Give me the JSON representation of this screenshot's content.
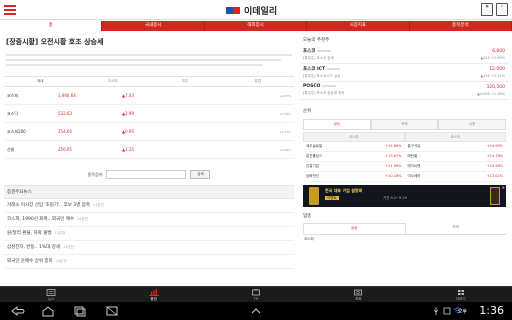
{
  "header": {
    "app_name": "이데일리",
    "right_icons": [
      "calendar-icon",
      "share-icon"
    ]
  },
  "tabs": [
    {
      "label": "홈",
      "active": true
    },
    {
      "label": "국내증시",
      "active": false
    },
    {
      "label": "해외증시",
      "active": false
    },
    {
      "label": "시장지표",
      "active": false
    },
    {
      "label": "종목분석",
      "active": false
    }
  ],
  "left": {
    "headline": "[장중시황] 오전시황 호조 상승세",
    "market_tabs": [
      "국내",
      "아시아",
      "미주",
      "유럽"
    ],
    "indices": [
      {
        "name": "코스피",
        "value": "1,990.64",
        "change": "▲7.43",
        "pct": "+0.37%"
      },
      {
        "name": "코스닥",
        "value": "532.63",
        "change": "▲2.99",
        "pct": "+0.56%"
      },
      {
        "name": "코스피200",
        "value": "254.65",
        "change": "▲0.95",
        "pct": "+0.37%"
      },
      {
        "name": "선물",
        "value": "256.05",
        "change": "▲1.25",
        "pct": "+0.49%"
      }
    ],
    "search": {
      "label": "종목검색",
      "button": "검색"
    },
    "news_section_title": "증권주요뉴스",
    "news": [
      {
        "title": "거래소 이사장 선임 '초읽기'.. 후보 3명 압축",
        "time": "14분전"
      },
      {
        "title": "코스피, 1990선 회복.. 외국인 매수",
        "time": "14분전"
      },
      {
        "title": "원/달러 환율, 하락 출발",
        "time": "14분전"
      },
      {
        "title": "삼성전자, 반등.. 1%대 강세",
        "time": "14분전"
      },
      {
        "title": "외국인 순매수 상위 종목",
        "time": "14분전"
      }
    ]
  },
  "right": {
    "reco_title": "오늘의 추천주",
    "recommendations": [
      {
        "name": "포스코",
        "code": "(005490)",
        "desc": "[특징주] 포스코 강세",
        "price": "6,600",
        "change": "▲120 +1.85%"
      },
      {
        "name": "포스코 ICT",
        "code": "(022100)",
        "desc": "[특징주] 포스코 ICT 상승",
        "price": "12,000",
        "change": "▲155 +1.31%"
      },
      {
        "name": "POSCO",
        "code": "(005490)",
        "desc": "[특징주] 포스코 상승세 지속",
        "price": "320,500",
        "change": "▲4,000 +1.26%"
      }
    ],
    "rank_title": "순위",
    "rank_tabs": [
      "상승",
      "하락",
      "시총"
    ],
    "rank_markets": [
      "코스피",
      "코스닥"
    ],
    "kospi_rank": [
      {
        "name": "세우글로벌",
        "pct": "+14.89%"
      },
      {
        "name": "일진홀딩스",
        "pct": "+13.67%"
      },
      {
        "name": "진흥기업",
        "pct": "+11.99%"
      },
      {
        "name": "삼화전선",
        "pct": "+10.16%"
      }
    ],
    "kosdaq_rank": [
      {
        "name": "홍구석유",
        "pct": "+14.99%"
      },
      {
        "name": "에탄올",
        "pct": "+14.78%"
      },
      {
        "name": "에이씨엔",
        "pct": "+14.56%"
      },
      {
        "name": "이노테라",
        "pct": "+13.01%"
      }
    ],
    "ad": {
      "title": "한국 대표 기업 설명회",
      "highlight": "이벤트",
      "sub": "기간 9.2~9.29"
    },
    "sector_title": "업종",
    "sector_tabs": [
      "상승",
      "하락"
    ],
    "sector_first": "코스피"
  },
  "dock": [
    {
      "label": "뉴스",
      "icon": "news-icon",
      "active": false
    },
    {
      "label": "증권",
      "icon": "chart-icon",
      "active": true
    },
    {
      "label": "TV",
      "icon": "tv-icon",
      "active": false
    },
    {
      "label": "포토",
      "icon": "photo-icon",
      "active": false
    },
    {
      "label": "더보기",
      "icon": "more-icon",
      "active": false
    }
  ],
  "status": {
    "ampm": "오후",
    "time": "1:36"
  },
  "colors": {
    "accent": "#d6271f",
    "up": "#d6271f"
  }
}
